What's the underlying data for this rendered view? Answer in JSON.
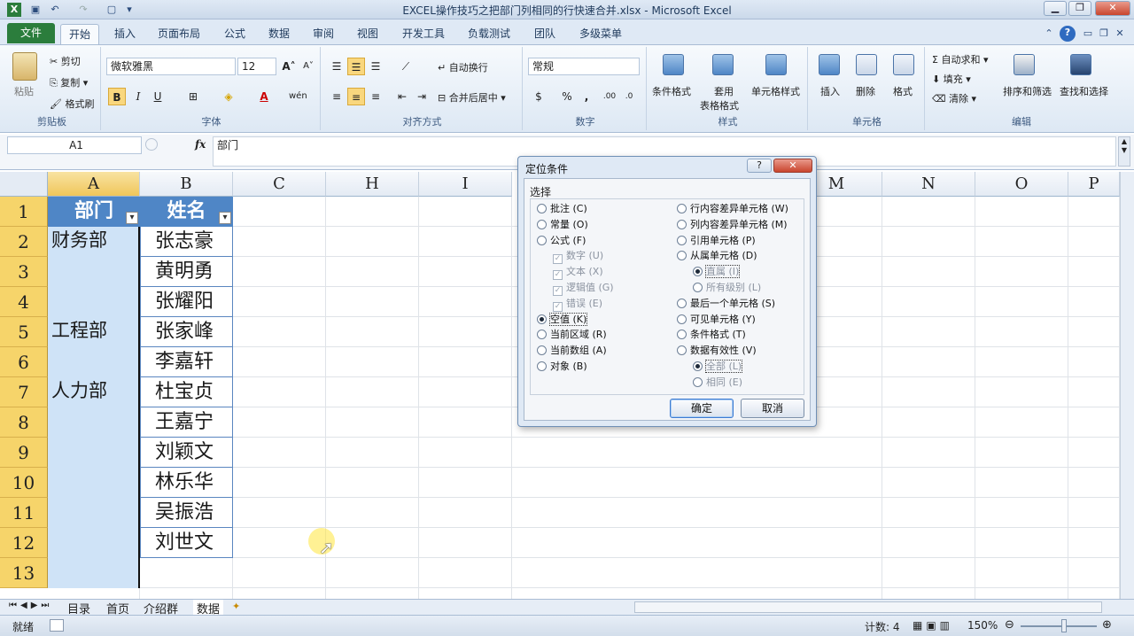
{
  "window": {
    "title": "EXCEL操作技巧之把部门列相同的行快速合并.xlsx - Microsoft Excel"
  },
  "ribbon_tabs": [
    "文件",
    "开始",
    "插入",
    "页面布局",
    "公式",
    "数据",
    "审阅",
    "视图",
    "开发工具",
    "负载测试",
    "团队",
    "多级菜单"
  ],
  "active_tab": "开始",
  "ribbon": {
    "clipboard": {
      "paste": "粘贴",
      "cut": "剪切",
      "copy": "复制",
      "format_painter": "格式刷",
      "label": "剪贴板"
    },
    "font": {
      "name": "微软雅黑",
      "size": "12",
      "label": "字体",
      "bold": "B",
      "italic": "I",
      "underline": "U"
    },
    "alignment": {
      "wrap": "自动换行",
      "merge": "合并后居中",
      "label": "对齐方式"
    },
    "number": {
      "format": "常规",
      "label": "数字",
      "percent": "%",
      "comma": ","
    },
    "styles": {
      "conditional": "条件格式",
      "table_1": "套用",
      "table_2": "表格格式",
      "cell_styles": "单元格样式",
      "label": "样式"
    },
    "cells": {
      "insert": "插入",
      "delete": "删除",
      "format": "格式",
      "label": "单元格"
    },
    "editing": {
      "autosum": "自动求和",
      "fill": "填充",
      "clear": "清除",
      "sort": "排序和筛选",
      "find": "查找和选择",
      "label": "编辑"
    }
  },
  "formula_bar": {
    "name_box": "A1",
    "fx": "fx",
    "content": "部门"
  },
  "columns": [
    "A",
    "B",
    "C",
    "H",
    "I",
    "M",
    "N",
    "O",
    "P"
  ],
  "rows": [
    "1",
    "2",
    "3",
    "4",
    "5",
    "6",
    "7",
    "8",
    "9",
    "10",
    "11",
    "12",
    "13"
  ],
  "table": {
    "headers": [
      "部门",
      "姓名"
    ],
    "departments": [
      "财务部",
      "",
      "",
      "工程部",
      "",
      "人力部",
      "",
      "",
      "",
      "",
      ""
    ],
    "names": [
      "张志豪",
      "黄明勇",
      "张耀阳",
      "张家峰",
      "李嘉轩",
      "杜宝贞",
      "王嘉宁",
      "刘颖文",
      "林乐华",
      "吴振浩",
      "刘世文"
    ]
  },
  "dialog": {
    "title": "定位条件",
    "help": "?",
    "group_label": "选择",
    "left_options": [
      "批注 (C)",
      "常量 (O)",
      "公式 (F)"
    ],
    "formula_sub": [
      "数字 (U)",
      "文本 (X)",
      "逻辑值 (G)",
      "错误 (E)"
    ],
    "left_options_2": [
      "空值 (K)",
      "当前区域 (R)",
      "当前数组 (A)",
      "对象 (B)"
    ],
    "right_options": [
      "行内容差异单元格 (W)",
      "列内容差异单元格 (M)",
      "引用单元格 (P)",
      "从属单元格 (D)"
    ],
    "dependents_sub": [
      "直属 (I)",
      "所有级别 (L)"
    ],
    "right_options_2": [
      "最后一个单元格 (S)",
      "可见单元格 (Y)",
      "条件格式 (T)",
      "数据有效性 (V)"
    ],
    "validation_sub": [
      "全部 (L)",
      "相同 (E)"
    ],
    "selected": "空值 (K)",
    "ok": "确定",
    "cancel": "取消"
  },
  "sheets": [
    "目录",
    "首页",
    "介绍群",
    "数据"
  ],
  "status": {
    "ready": "就绪",
    "count": "计数: 4",
    "zoom": "150%"
  },
  "colors": {
    "header_fill": "#4f86c6",
    "selection_fill": "#cfe3f7",
    "row_header": "#f6d46a",
    "file_tab": "#2b7d3c"
  }
}
